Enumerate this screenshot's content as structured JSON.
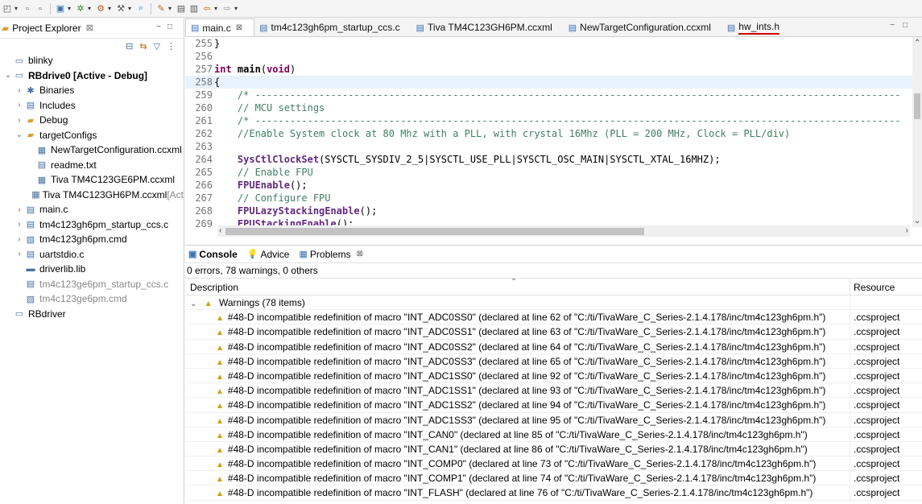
{
  "toolbar": {
    "icons": [
      "new-icon",
      "save-icon",
      "save-all-icon",
      "build-icon",
      "debug-icon",
      "flash-icon",
      "tools-icon",
      "search-icon",
      "pen-icon",
      "toggle-icon",
      "back-icon",
      "forward-icon"
    ]
  },
  "project_explorer": {
    "title": "Project Explorer",
    "close_glyph": "⊠",
    "items": [
      {
        "label": "blinky",
        "chev": "",
        "indent": 0,
        "icon": "▭",
        "style": ""
      },
      {
        "label": "RBdrive0  [Active - Debug]",
        "chev": "⌄",
        "indent": 0,
        "icon": "▭",
        "style": "bold"
      },
      {
        "label": "Binaries",
        "chev": "›",
        "indent": 1,
        "icon": "✱",
        "style": ""
      },
      {
        "label": "Includes",
        "chev": "›",
        "indent": 1,
        "icon": "▤",
        "style": ""
      },
      {
        "label": "Debug",
        "chev": "›",
        "indent": 1,
        "icon": "▰",
        "style": ""
      },
      {
        "label": "targetConfigs",
        "chev": "⌄",
        "indent": 1,
        "icon": "▰",
        "style": ""
      },
      {
        "label": "NewTargetConfiguration.ccxml",
        "chev": "",
        "indent": 2,
        "icon": "▦",
        "style": ""
      },
      {
        "label": "readme.txt",
        "chev": "",
        "indent": 2,
        "icon": "▤",
        "style": ""
      },
      {
        "label": "Tiva TM4C123GE6PM.ccxml",
        "chev": "",
        "indent": 2,
        "icon": "▦",
        "style": ""
      },
      {
        "label": "Tiva TM4C123GH6PM.ccxml",
        "suffix": " [Act",
        "chev": "",
        "indent": 2,
        "icon": "▦",
        "style": ""
      },
      {
        "label": "main.c",
        "chev": "›",
        "indent": 1,
        "icon": "▤",
        "style": ""
      },
      {
        "label": "tm4c123gh6pm_startup_ccs.c",
        "chev": "›",
        "indent": 1,
        "icon": "▤",
        "style": ""
      },
      {
        "label": "tm4c123gh6pm.cmd",
        "chev": "›",
        "indent": 1,
        "icon": "▧",
        "style": ""
      },
      {
        "label": "uartstdio.c",
        "chev": "›",
        "indent": 1,
        "icon": "▤",
        "style": ""
      },
      {
        "label": "driverlib.lib",
        "chev": "",
        "indent": 1,
        "icon": "▬",
        "style": ""
      },
      {
        "label": "tm4c123ge6pm_startup_ccs.c",
        "chev": "",
        "indent": 1,
        "icon": "▤",
        "style": "grey"
      },
      {
        "label": "tm4c123ge6pm.cmd",
        "chev": "",
        "indent": 1,
        "icon": "▧",
        "style": "grey"
      },
      {
        "label": "RBdriver",
        "chev": "",
        "indent": 0,
        "icon": "▭",
        "style": ""
      }
    ]
  },
  "editor": {
    "tabs": [
      {
        "label": "main.c",
        "active": true,
        "close": "⊠"
      },
      {
        "label": "tm4c123gh6pm_startup_ccs.c",
        "active": false,
        "close": ""
      },
      {
        "label": "Tiva TM4C123GH6PM.ccxml",
        "active": false,
        "close": ""
      },
      {
        "label": "NewTargetConfiguration.ccxml",
        "active": false,
        "close": ""
      },
      {
        "label": "hw_ints.h",
        "active": false,
        "close": "",
        "underlined": true
      }
    ],
    "lines": [
      {
        "n": "255",
        "html": "<span>}</span>"
      },
      {
        "n": "256",
        "html": ""
      },
      {
        "n": "257",
        "html": "<span class=\"kw\">int</span> <span class=\"bold\">main</span>(<span class=\"kw\">void</span>)"
      },
      {
        "n": "258",
        "html": "{",
        "highlight": true
      },
      {
        "n": "259",
        "html": "    <span class=\"cm\">/* ---------------------------------------------------------------------------------------------------------------</span>"
      },
      {
        "n": "260",
        "html": "    <span class=\"cm\">// MCU settings</span>"
      },
      {
        "n": "261",
        "html": "    <span class=\"cm\">/* ---------------------------------------------------------------------------------------------------------------</span>"
      },
      {
        "n": "262",
        "html": "    <span class=\"cm\">//Enable System clock at 80 Mhz with a PLL, with crystal 16Mhz (PLL = 200 MHz, Clock = PLL/div)</span>"
      },
      {
        "n": "263",
        "html": ""
      },
      {
        "n": "264",
        "html": "    <span class=\"fn\">SysCtlClockSet</span>(SYSCTL_SYSDIV_2_5|SYSCTL_USE_PLL|SYSCTL_OSC_MAIN|SYSCTL_XTAL_16MHZ);"
      },
      {
        "n": "265",
        "html": "    <span class=\"cm\">// Enable FPU</span>"
      },
      {
        "n": "266",
        "html": "    <span class=\"fn\">FPUEnable</span>();"
      },
      {
        "n": "267",
        "html": "    <span class=\"cm\">// Configure FPU</span>"
      },
      {
        "n": "268",
        "html": "    <span class=\"fn\">FPULazyStackingEnable</span>();"
      },
      {
        "n": "269",
        "html": "    <span class=\"fn\">FPUStackingEnable</span>();"
      }
    ]
  },
  "bottom_panel": {
    "tabs": [
      {
        "label": "Console",
        "icon": "▣",
        "bold": true
      },
      {
        "label": "Advice",
        "icon": "💡",
        "bold": false
      },
      {
        "label": "Problems",
        "icon": "▦",
        "bold": false,
        "close": "⊠"
      }
    ],
    "summary": "0 errors, 78 warnings, 0 others",
    "columns": {
      "description": "Description",
      "resource": "Resource"
    },
    "group": {
      "label": "Warnings (78 items)",
      "resource": ""
    },
    "rows": [
      {
        "desc": "#48-D incompatible redefinition of macro \"INT_ADC0SS0\" (declared at line 62 of \"C:/ti/TivaWare_C_Series-2.1.4.178/inc/tm4c123gh6pm.h\")",
        "res": ".ccsproject"
      },
      {
        "desc": "#48-D incompatible redefinition of macro \"INT_ADC0SS1\" (declared at line 63 of \"C:/ti/TivaWare_C_Series-2.1.4.178/inc/tm4c123gh6pm.h\")",
        "res": ".ccsproject"
      },
      {
        "desc": "#48-D incompatible redefinition of macro \"INT_ADC0SS2\" (declared at line 64 of \"C:/ti/TivaWare_C_Series-2.1.4.178/inc/tm4c123gh6pm.h\")",
        "res": ".ccsproject"
      },
      {
        "desc": "#48-D incompatible redefinition of macro \"INT_ADC0SS3\" (declared at line 65 of \"C:/ti/TivaWare_C_Series-2.1.4.178/inc/tm4c123gh6pm.h\")",
        "res": ".ccsproject"
      },
      {
        "desc": "#48-D incompatible redefinition of macro \"INT_ADC1SS0\" (declared at line 92 of \"C:/ti/TivaWare_C_Series-2.1.4.178/inc/tm4c123gh6pm.h\")",
        "res": ".ccsproject"
      },
      {
        "desc": "#48-D incompatible redefinition of macro \"INT_ADC1SS1\" (declared at line 93 of \"C:/ti/TivaWare_C_Series-2.1.4.178/inc/tm4c123gh6pm.h\")",
        "res": ".ccsproject"
      },
      {
        "desc": "#48-D incompatible redefinition of macro \"INT_ADC1SS2\" (declared at line 94 of \"C:/ti/TivaWare_C_Series-2.1.4.178/inc/tm4c123gh6pm.h\")",
        "res": ".ccsproject"
      },
      {
        "desc": "#48-D incompatible redefinition of macro \"INT_ADC1SS3\" (declared at line 95 of \"C:/ti/TivaWare_C_Series-2.1.4.178/inc/tm4c123gh6pm.h\")",
        "res": ".ccsproject"
      },
      {
        "desc": "#48-D incompatible redefinition of macro \"INT_CAN0\" (declared at line 85 of \"C:/ti/TivaWare_C_Series-2.1.4.178/inc/tm4c123gh6pm.h\")",
        "res": ".ccsproject"
      },
      {
        "desc": "#48-D incompatible redefinition of macro \"INT_CAN1\" (declared at line 86 of \"C:/ti/TivaWare_C_Series-2.1.4.178/inc/tm4c123gh6pm.h\")",
        "res": ".ccsproject"
      },
      {
        "desc": "#48-D incompatible redefinition of macro \"INT_COMP0\" (declared at line 73 of \"C:/ti/TivaWare_C_Series-2.1.4.178/inc/tm4c123gh6pm.h\")",
        "res": ".ccsproject"
      },
      {
        "desc": "#48-D incompatible redefinition of macro \"INT_COMP1\" (declared at line 74 of \"C:/ti/TivaWare_C_Series-2.1.4.178/inc/tm4c123gh6pm.h\")",
        "res": ".ccsproject"
      },
      {
        "desc": "#48-D incompatible redefinition of macro \"INT_FLASH\" (declared at line 76 of \"C:/ti/TivaWare_C_Series-2.1.4.178/inc/tm4c123gh6pm.h\")",
        "res": ".ccsproject"
      }
    ]
  },
  "colors": {
    "accent": "#3c6fb4",
    "warning": "#d89a00",
    "annotation": "#d00000",
    "current_line": "#e8f2fe"
  }
}
